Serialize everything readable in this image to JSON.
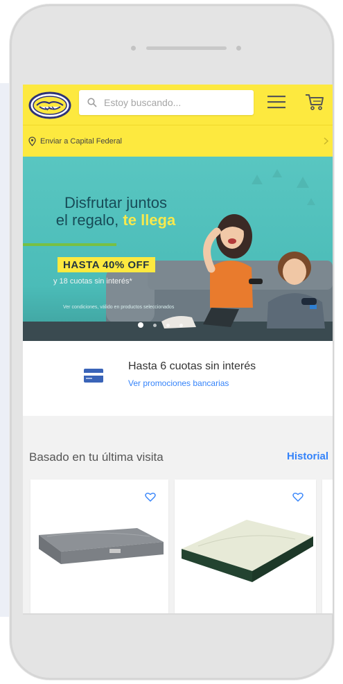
{
  "header": {
    "search_placeholder": "Estoy buscando...",
    "logo_icon": "mercadolibre-handshake-logo",
    "menu_icon": "hamburger-menu-icon",
    "cart_icon": "cart-icon"
  },
  "shipping": {
    "label": "Enviar a Capital Federal",
    "icon": "location-pin-icon"
  },
  "banner": {
    "title_line1": "Disfrutar juntos",
    "title_line2": "el regalo,",
    "title_highlight": "te llega",
    "offer": "HASTA 40% OFF",
    "subline": "y 18 cuotas sin interés*",
    "legal": "Ver condiciones, válido en productos seleccionados",
    "slide_count": 3,
    "active_slide": 1
  },
  "promo": {
    "title": "Hasta 6 cuotas sin interés",
    "link": "Ver promociones bancarias",
    "icon": "credit-card-icon"
  },
  "recommendations": {
    "section_title": "Basado en tu última visita",
    "history_link": "Historial",
    "items": [
      {
        "image": "gray-mattress",
        "fav_icon": "heart-icon"
      },
      {
        "image": "white-green-mattress",
        "fav_icon": "heart-icon"
      }
    ]
  },
  "colors": {
    "brand_yellow": "#fde93f",
    "link_blue": "#3483fa",
    "banner_teal": "#59c6c1",
    "offer_green": "#77c043"
  }
}
